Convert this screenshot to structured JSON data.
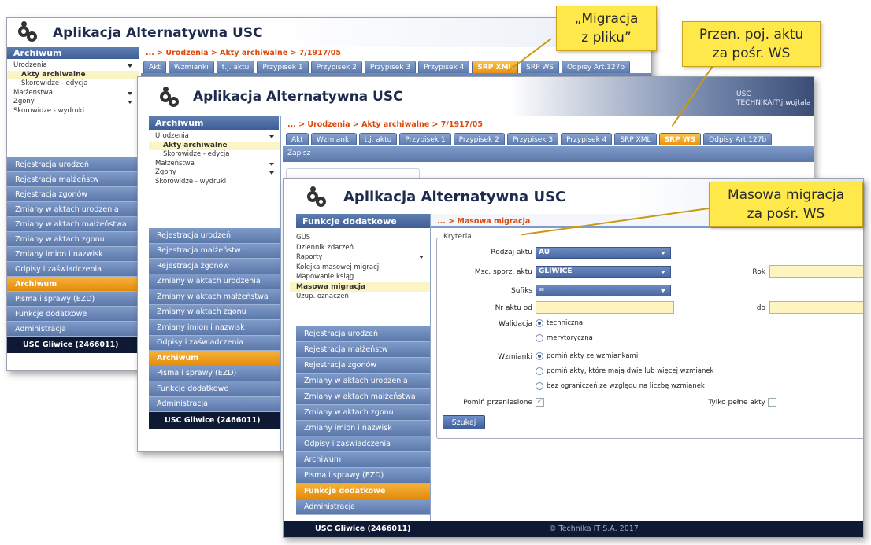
{
  "app_title": "Aplikacja Alternatywna USC",
  "window1": {
    "sidebar_header": "Archiwum",
    "tree": [
      {
        "label": "Urodzenia",
        "arrow": true
      },
      {
        "label": "Akty archiwalne",
        "selected": true
      },
      {
        "label": "Skorowidze - edycja",
        "indent": true
      },
      {
        "label": "Małżeństwa",
        "arrow": true
      },
      {
        "label": "Zgony",
        "arrow": true
      },
      {
        "label": "Skorowidze - wydruki"
      }
    ],
    "nav": [
      "Rejestracja urodzeń",
      "Rejestracja małżeństw",
      "Rejestracja zgonów",
      "Zmiany w aktach urodzenia",
      "Zmiany w aktach małżeństwa",
      "Zmiany w aktach zgonu",
      "Zmiany imion i nazwisk",
      "Odpisy i zaświadczenia",
      "Archiwum",
      "Pisma i sprawy (EZD)",
      "Funkcje dodatkowe",
      "Administracja"
    ],
    "nav_active": "Archiwum",
    "footer": "USC Gliwice (2466011)",
    "breadcrumb": "... > Urodzenia > Akty archiwalne > 7/1917/05",
    "tabs": [
      "Akt",
      "Wzmianki",
      "t.j. aktu",
      "Przypisek 1",
      "Przypisek 2",
      "Przypisek 3",
      "Przypisek 4",
      "SRP XML",
      "SRP WS",
      "Odpisy Art.127b"
    ],
    "active_tab": "SRP XML"
  },
  "window2": {
    "user_line1": "USC",
    "user_line2": "TECHNIKAIT\\j.wojtala",
    "sidebar_header": "Archiwum",
    "tree": [
      {
        "label": "Urodzenia",
        "arrow": true
      },
      {
        "label": "Akty archiwalne",
        "selected": true
      },
      {
        "label": "Skorowidze - edycja",
        "indent": true
      },
      {
        "label": "Małżeństwa",
        "arrow": true
      },
      {
        "label": "Zgony",
        "arrow": true
      },
      {
        "label": "Skorowidze - wydruki"
      }
    ],
    "nav": [
      "Rejestracja urodzeń",
      "Rejestracja małżeństw",
      "Rejestracja zgonów",
      "Zmiany w aktach urodzenia",
      "Zmiany w aktach małżeństwa",
      "Zmiany w aktach zgonu",
      "Zmiany imion i nazwisk",
      "Odpisy i zaświadczenia",
      "Archiwum",
      "Pisma i sprawy (EZD)",
      "Funkcje dodatkowe",
      "Administracja"
    ],
    "nav_active": "Archiwum",
    "footer": "USC Gliwice (2466011)",
    "breadcrumb": "... > Urodzenia > Akty archiwalne > 7/1917/05",
    "tabs": [
      "Akt",
      "Wzmianki",
      "t.j. aktu",
      "Przypisek 1",
      "Przypisek 2",
      "Przypisek 3",
      "Przypisek 4",
      "SRP XML",
      "SRP WS",
      "Odpisy Art.127b"
    ],
    "active_tab": "SRP WS",
    "save_label": "Zapisz"
  },
  "window3": {
    "sidebar_header": "Funkcje dodatkowe",
    "tree": [
      {
        "label": "GUS"
      },
      {
        "label": "Dziennik zdarzeń"
      },
      {
        "label": "Raporty",
        "arrow": true
      },
      {
        "label": "Kolejka masowej migracji"
      },
      {
        "label": "Mapowanie ksiąg"
      },
      {
        "label": "Masowa migracja",
        "selected": true
      },
      {
        "label": "Uzup. oznaczeń"
      }
    ],
    "nav": [
      "Rejestracja urodzeń",
      "Rejestracja małżeństw",
      "Rejestracja zgonów",
      "Zmiany w aktach urodzenia",
      "Zmiany w aktach małżeństwa",
      "Zmiany w aktach zgonu",
      "Zmiany imion i nazwisk",
      "Odpisy i zaświadczenia",
      "Archiwum",
      "Pisma i sprawy (EZD)",
      "Funkcje dodatkowe",
      "Administracja"
    ],
    "nav_active": "Funkcje dodatkowe",
    "footer": "USC Gliwice (2466011)",
    "copyright": "© Technika IT S.A. 2017",
    "breadcrumb": "... > Masowa migracja",
    "form": {
      "legend": "Kryteria",
      "rodzaj_label": "Rodzaj aktu",
      "rodzaj_value": "AU",
      "msc_label": "Msc. sporz. aktu",
      "msc_value": "GLIWICE",
      "rok_label": "Rok",
      "sufiks_label": "Sufiks",
      "sufiks_value": "=",
      "nr_od_label": "Nr aktu od",
      "do_label": "do",
      "walidacja_label": "Walidacja",
      "walidacja_opts": [
        "techniczna",
        "merytoryczna"
      ],
      "wzmianki_label": "Wzmianki",
      "wzmianki_opts": [
        "pomiń akty ze wzmiankami",
        "pomiń akty, które mają dwie lub więcej wzmianek",
        "bez ograniczeń ze względu na liczbę wzmianek"
      ],
      "pomin_label": "Pomiń przeniesione",
      "tylko_label": "Tylko pełne akty",
      "search_label": "Szukaj"
    }
  },
  "callouts": {
    "c1_line1": "„Migracja",
    "c1_line2": "z pliku”",
    "c2_line1": "Przen. poj. aktu",
    "c2_line2": "za pośr. WS",
    "c3_line1": "Masowa migracja",
    "c3_line2": "za pośr. WS"
  }
}
